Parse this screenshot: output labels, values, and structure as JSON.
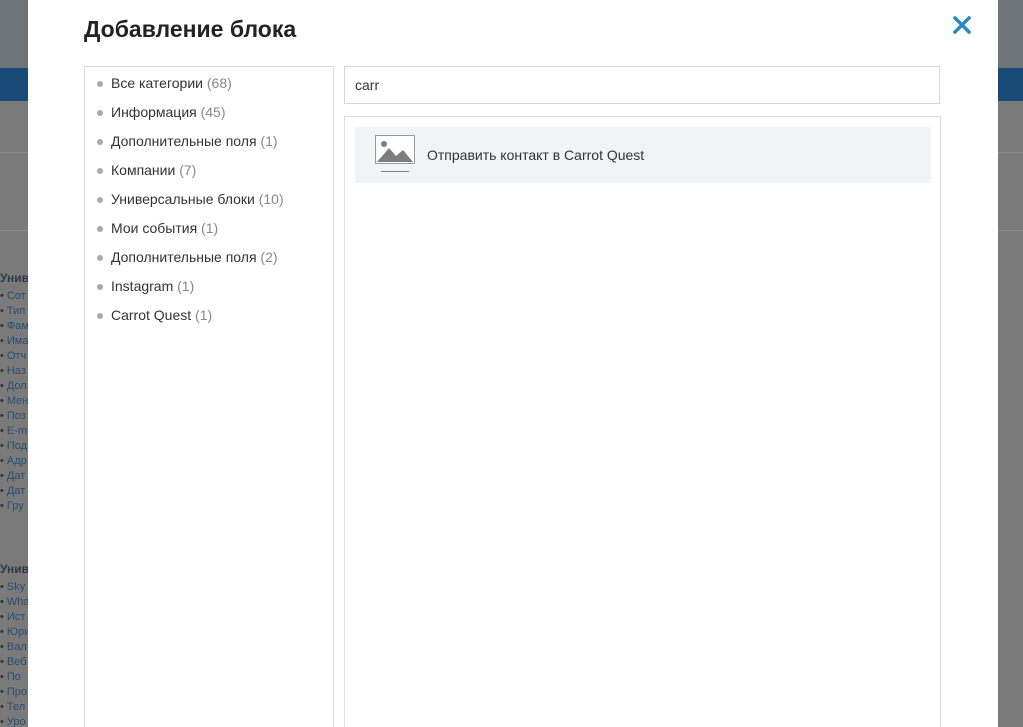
{
  "background": {
    "section_1_title": "Унив",
    "section_1_items": [
      "Сот",
      "Тип",
      "Фам",
      "Има",
      "Отч",
      "Наз",
      "Дол",
      "Мен",
      "Поз",
      "E-m",
      "Под",
      "Адр",
      "Дат",
      "Дат",
      "Гру"
    ],
    "section_2_title": "Унив",
    "section_2_items": [
      "Sky",
      "Wha",
      "Ист",
      "Юри",
      "Вал",
      "Веб",
      "По",
      "Про",
      "Тел",
      "Уро"
    ]
  },
  "modal": {
    "title": "Добавление блока",
    "close_icon": "close-icon",
    "categories": [
      {
        "label": "Все категории",
        "count": "(68)"
      },
      {
        "label": "Информация",
        "count": "(45)"
      },
      {
        "label": "Дополнительные поля",
        "count": "(1)"
      },
      {
        "label": "Компании",
        "count": "(7)"
      },
      {
        "label": "Универсальные блоки",
        "count": "(10)"
      },
      {
        "label": "Мои события",
        "count": "(1)"
      },
      {
        "label": "Дополнительные поля",
        "count": "(2)"
      },
      {
        "label": "Instagram",
        "count": "(1)"
      },
      {
        "label": "Carrot Quest",
        "count": "(1)"
      }
    ],
    "search": {
      "value": "carr"
    },
    "results": [
      {
        "label": "Отправить контакт в Carrot Quest",
        "icon": "image-placeholder-icon"
      }
    ]
  },
  "colors": {
    "accent": "#2a86c9",
    "overlay": "#7a7a7a",
    "result_bg": "#f2f3f5"
  }
}
